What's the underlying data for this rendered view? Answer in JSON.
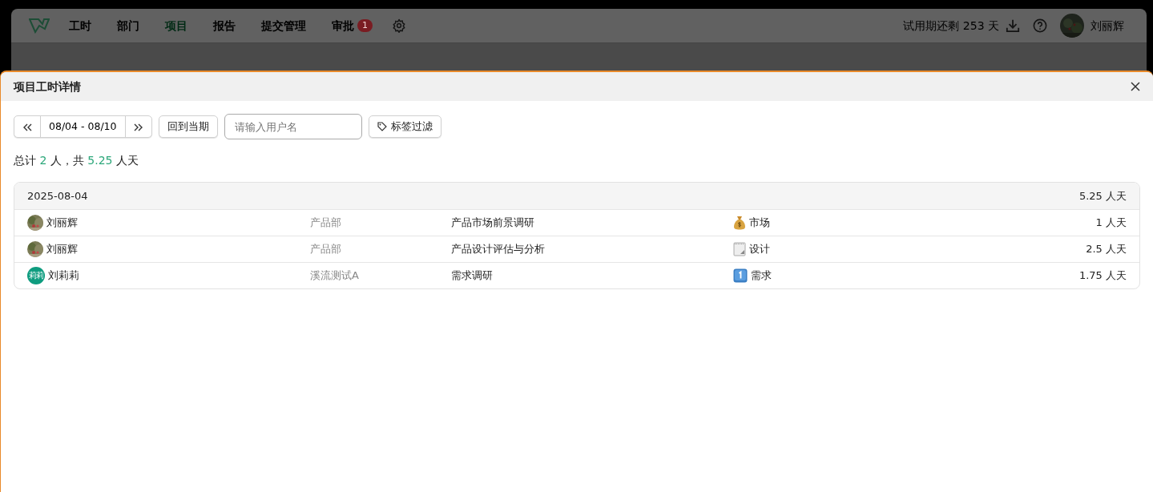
{
  "nav": {
    "items": [
      {
        "label": "工时",
        "selected": false
      },
      {
        "label": "部门",
        "selected": false
      },
      {
        "label": "项目",
        "selected": true
      },
      {
        "label": "报告",
        "selected": false
      },
      {
        "label": "提交管理",
        "selected": false
      },
      {
        "label": "审批",
        "selected": false,
        "badge": "1"
      }
    ],
    "trial": "试用期还剩 253 天",
    "user": "刘丽辉"
  },
  "modal": {
    "title": "项目工时详情",
    "toolbar": {
      "range": "08/04 - 08/10",
      "current": "回到当期",
      "search_placeholder": "请输入用户名",
      "tag_filter": "标签过滤"
    },
    "summary": "总计 **2** 人，共 **5.25** 人天",
    "groups": [
      {
        "date": "2025-08-04",
        "total": "5.25 人天",
        "rows": [
          {
            "user": "刘丽辉",
            "dept": "产品部",
            "task": "产品市场前景调研",
            "tag": {
              "kind": "moneybag",
              "label": "市场"
            },
            "amount": "1 人天"
          },
          {
            "user": "刘丽辉",
            "dept": "产品部",
            "task": "产品设计评估与分析",
            "tag": {
              "kind": "notepad",
              "label": "设计"
            },
            "amount": "2.5 人天"
          },
          {
            "user": "刘莉莉",
            "avatar": {
              "kind": "initials",
              "text": "莉莉"
            },
            "dept": "溪流测试A",
            "task": "需求调研",
            "tag": {
              "kind": "keycap",
              "label": "需求"
            },
            "amount": "1.75 人天"
          }
        ]
      }
    ]
  }
}
